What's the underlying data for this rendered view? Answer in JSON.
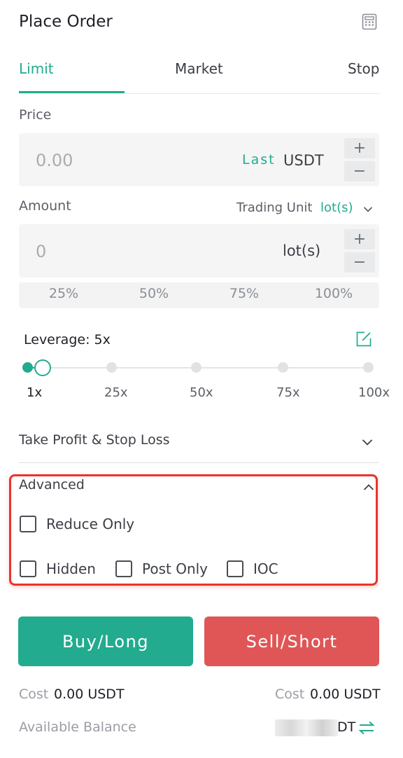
{
  "header": {
    "title": "Place Order",
    "calculator_icon": "calculator-icon"
  },
  "tabs": [
    {
      "label": "Limit",
      "active": true
    },
    {
      "label": "Market",
      "active": false
    },
    {
      "label": "Stop",
      "active": false
    }
  ],
  "price": {
    "label": "Price",
    "placeholder": "0.00",
    "last_label": "Last",
    "unit": "USDT",
    "plus": "+",
    "minus": "−"
  },
  "amount": {
    "label": "Amount",
    "trading_unit_label": "Trading Unit",
    "trading_unit_value": "lot(s)",
    "placeholder": "0",
    "unit": "lot(s)",
    "plus": "+",
    "minus": "−"
  },
  "percentages": [
    "25%",
    "50%",
    "75%",
    "100%"
  ],
  "leverage": {
    "label": "Leverage: 5x",
    "ticks": [
      "1x",
      "25x",
      "50x",
      "75x",
      "100x"
    ],
    "value_fraction": 0.04
  },
  "tpsl": {
    "label": "Take Profit & Stop Loss"
  },
  "advanced": {
    "label": "Advanced",
    "options": {
      "reduce_only": "Reduce Only",
      "hidden": "Hidden",
      "post_only": "Post Only",
      "ioc": "IOC"
    }
  },
  "buttons": {
    "buy": "Buy/Long",
    "sell": "Sell/Short"
  },
  "cost": {
    "label": "Cost",
    "buy_value": "0.00 USDT",
    "sell_value": "0.00 USDT"
  },
  "balance": {
    "label": "Available Balance",
    "value_visible": "DT"
  },
  "colors": {
    "accent": "#22ab8e",
    "sell": "#e05656",
    "highlight": "#e8352b"
  }
}
